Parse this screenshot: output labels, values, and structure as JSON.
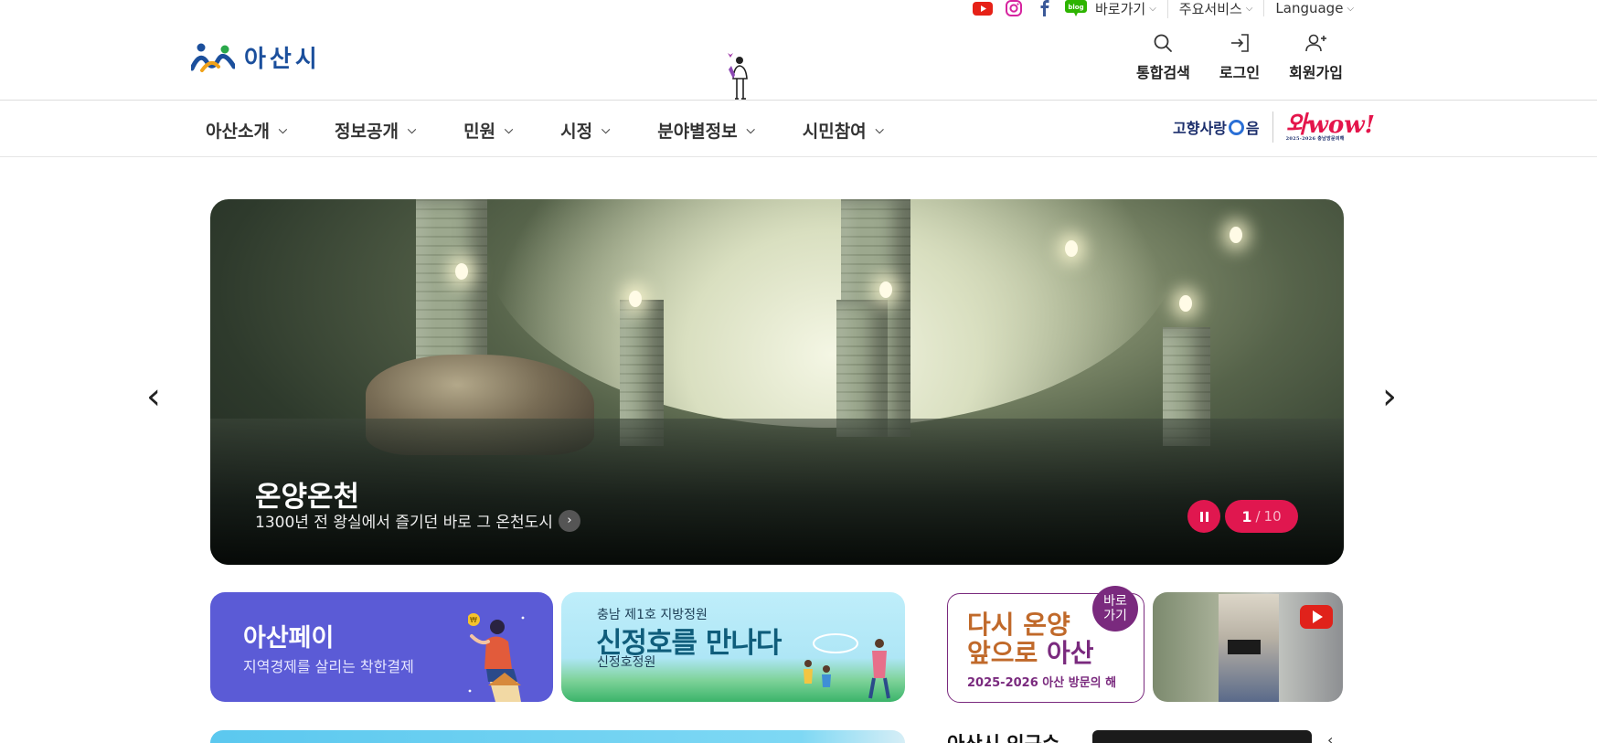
{
  "top_utility": {
    "sns": [
      {
        "name": "youtube",
        "color": "#e62117"
      },
      {
        "name": "instagram",
        "color": "#d6249f"
      },
      {
        "name": "facebook",
        "color": "#3b5998"
      },
      {
        "name": "blog",
        "label": "blog",
        "color": "#2db400"
      }
    ],
    "links": [
      {
        "label": "바로가기"
      },
      {
        "label": "주요서비스"
      },
      {
        "label": "Language"
      }
    ]
  },
  "header": {
    "logo_text": "아산시",
    "util": [
      {
        "label": "통합검색",
        "icon": "search-icon"
      },
      {
        "label": "로그인",
        "icon": "login-icon"
      },
      {
        "label": "회원가입",
        "icon": "add-user-icon"
      }
    ]
  },
  "gnb": {
    "items": [
      {
        "label": "아산소개"
      },
      {
        "label": "정보공개"
      },
      {
        "label": "민원"
      },
      {
        "label": "시정"
      },
      {
        "label": "분야별정보"
      },
      {
        "label": "시민참여"
      }
    ],
    "hometown_label_a": "고향사랑",
    "hometown_label_b": "음",
    "wow_label": "와wow!",
    "wow_sub": "2025-2026 충남방문의해"
  },
  "hero": {
    "title": "온양온천",
    "subtitle": "1300년 전 왕실에서 즐기던 바로 그 온천도시",
    "current": "1",
    "separator": "/",
    "total": "10",
    "accent": "#e0174f"
  },
  "banners": {
    "pay": {
      "title": "아산페이",
      "sub": "지역경제를 살리는 착한결제",
      "coin": "₩"
    },
    "lake": {
      "kicker": "충남 제1호 지방정원",
      "title": "신정호를 만나다",
      "sub": "신정호정원"
    },
    "visit": {
      "line1": "다시 온양",
      "line2a": "앞으로 ",
      "line2b": "아산",
      "sub": "2025-2026 아산 방문의 해",
      "badge_1": "바로",
      "badge_2": "가기"
    }
  },
  "bottom": {
    "pop_title": "아산시 인구수"
  }
}
